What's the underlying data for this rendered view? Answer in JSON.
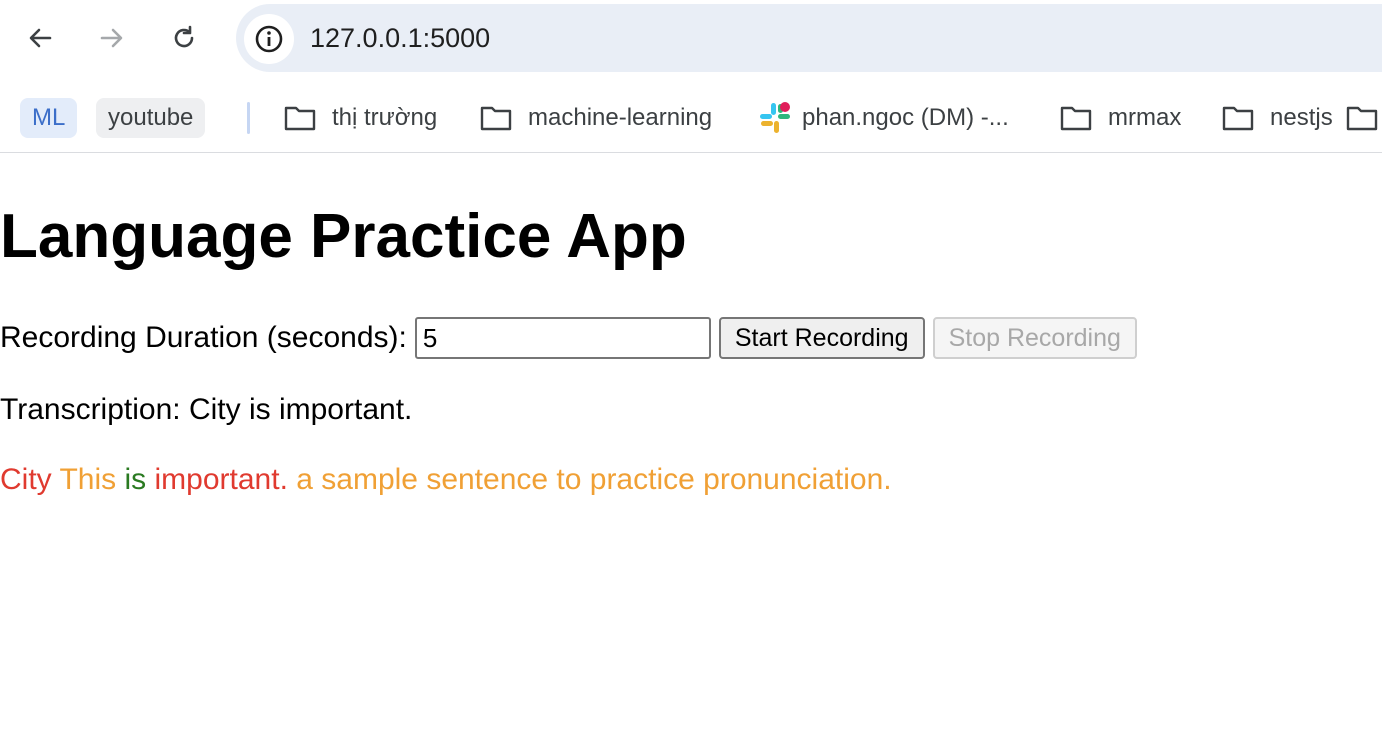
{
  "browser": {
    "url": "127.0.0.1:5000",
    "bookmarks": {
      "chips": [
        "ML",
        "youtube"
      ],
      "folders": [
        "thị trường",
        "machine-learning",
        "phan.ngoc (DM) -...",
        "mrmax",
        "nestjs"
      ]
    }
  },
  "app": {
    "title": "Language Practice App",
    "duration_label": "Recording Duration (seconds):",
    "duration_value": "5",
    "start_button": "Start Recording",
    "stop_button": "Stop Recording",
    "transcription_label": "Transcription:",
    "transcription_text": "City is important.",
    "sentence_words": [
      {
        "text": "City",
        "status": "error"
      },
      {
        "text": "This",
        "status": "missing"
      },
      {
        "text": "is",
        "status": "correct"
      },
      {
        "text": "important.",
        "status": "error"
      },
      {
        "text": "a sample sentence to practice pronunciation.",
        "status": "missing"
      }
    ]
  },
  "colors": {
    "error": "#e03a2f",
    "missing": "#f0a035",
    "correct": "#2a7a21",
    "ml_chip": "#3b6ec9"
  }
}
